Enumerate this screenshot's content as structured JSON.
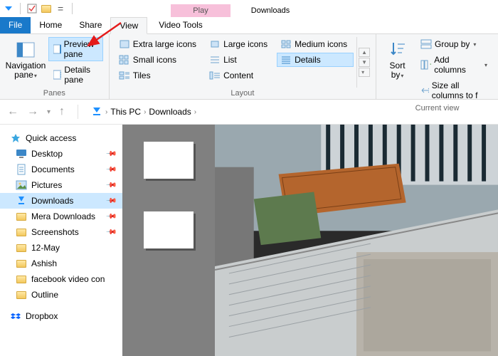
{
  "window": {
    "contextTabs": {
      "play": "Play",
      "location": "Downloads",
      "toolsTab": "Video Tools"
    }
  },
  "tabs": {
    "file": "File",
    "home": "Home",
    "share": "Share",
    "view": "View"
  },
  "ribbon": {
    "panes": {
      "groupLabel": "Panes",
      "navigation": "Navigation\npane",
      "preview": "Preview pane",
      "details": "Details pane"
    },
    "layout": {
      "groupLabel": "Layout",
      "extraLarge": "Extra large icons",
      "large": "Large icons",
      "medium": "Medium icons",
      "small": "Small icons",
      "list": "List",
      "detailsOpt": "Details",
      "tiles": "Tiles",
      "content": "Content"
    },
    "currentView": {
      "groupLabel": "Current view",
      "sortBy": "Sort\nby",
      "groupBy": "Group by",
      "addColumns": "Add columns",
      "sizeAll": "Size all columns to f"
    }
  },
  "breadcrumb": {
    "thisPC": "This PC",
    "downloads": "Downloads"
  },
  "sidebar": {
    "quickAccess": "Quick access",
    "items": [
      {
        "label": "Desktop",
        "icon": "desktop",
        "pinned": true
      },
      {
        "label": "Documents",
        "icon": "documents",
        "pinned": true
      },
      {
        "label": "Pictures",
        "icon": "pictures",
        "pinned": true
      },
      {
        "label": "Downloads",
        "icon": "downloads",
        "pinned": true,
        "selected": true
      },
      {
        "label": "Mera Downloads",
        "icon": "folder",
        "pinned": true
      },
      {
        "label": "Screenshots",
        "icon": "folder",
        "pinned": true
      },
      {
        "label": "12-May",
        "icon": "folder",
        "pinned": false
      },
      {
        "label": "Ashish",
        "icon": "folder",
        "pinned": false
      },
      {
        "label": "facebook video con",
        "icon": "folder",
        "pinned": false
      },
      {
        "label": "Outline",
        "icon": "folder",
        "pinned": false
      }
    ],
    "dropbox": "Dropbox"
  }
}
